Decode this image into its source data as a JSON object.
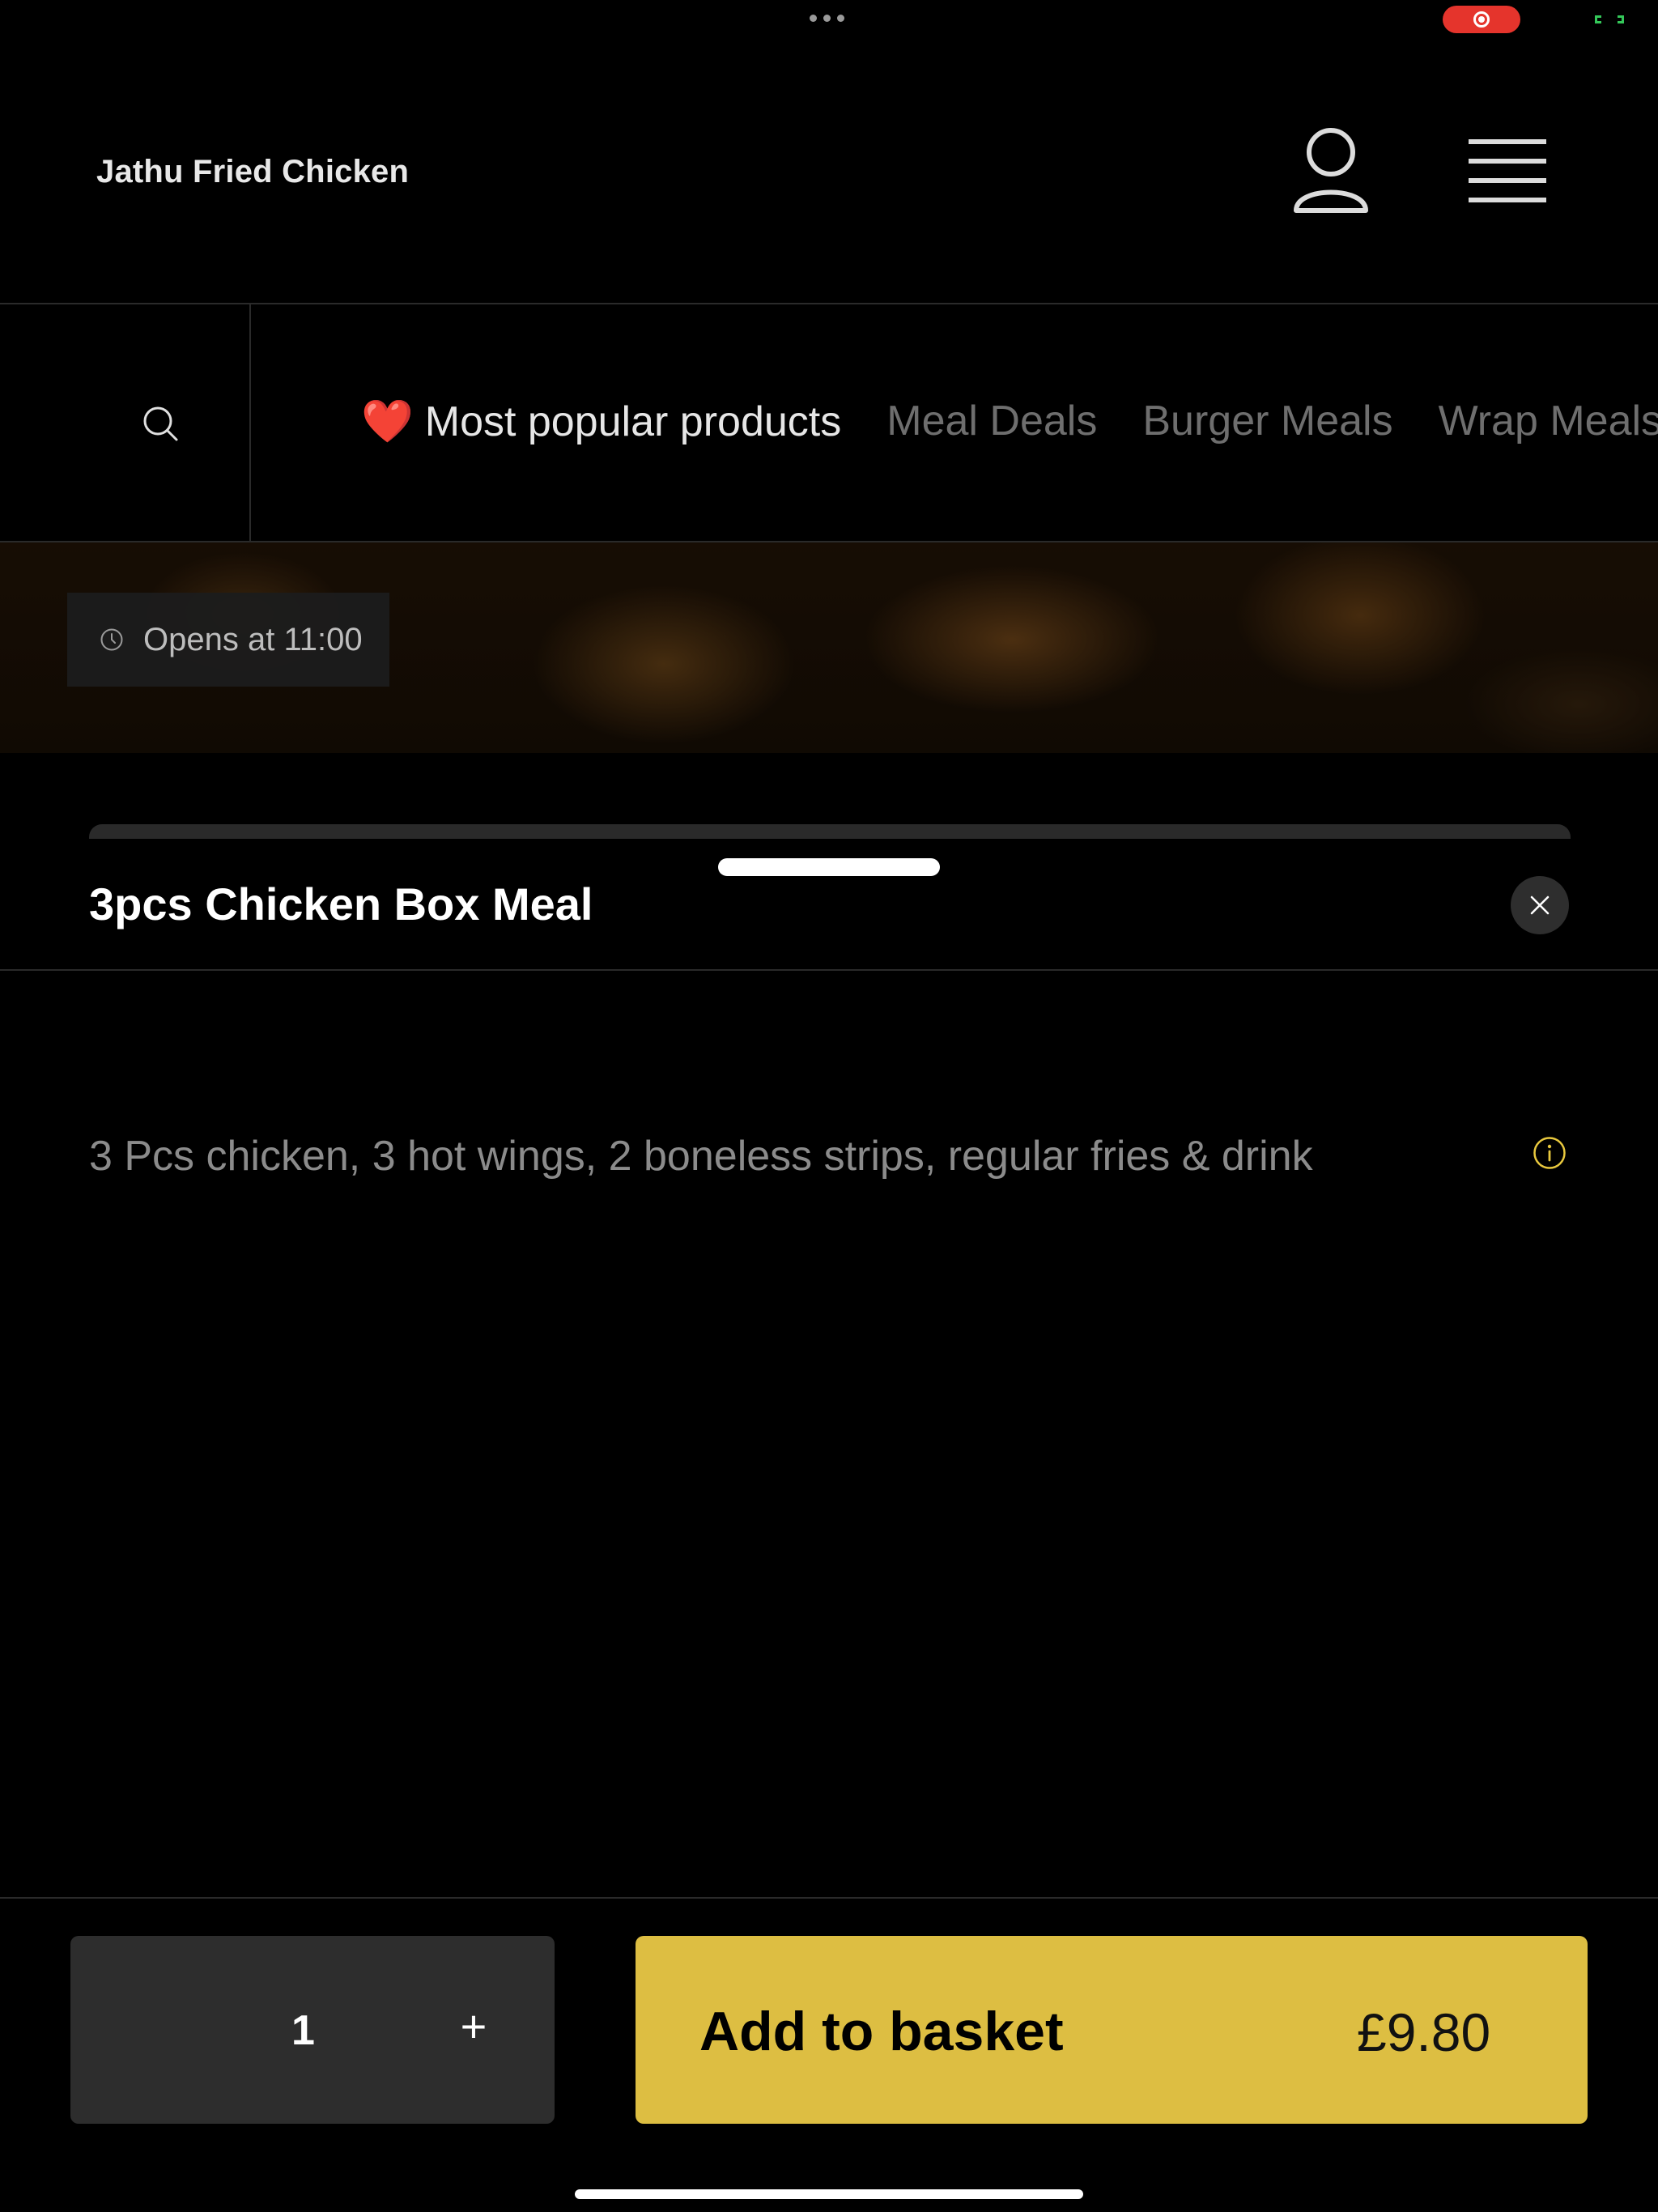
{
  "status_bar": {
    "dots_icon": "more-dots-icon",
    "record_icon": "screen-record-icon",
    "battery_icon": "battery-icon",
    "record_color": "#e5342c"
  },
  "header": {
    "brand": "Jathu Fried Chicken",
    "account_icon": "user-icon",
    "menu_icon": "hamburger-menu-icon"
  },
  "categories": {
    "search_icon": "search-icon",
    "items": [
      {
        "emoji": "❤️",
        "label": "Most popular products",
        "active": true
      },
      {
        "label": "Meal Deals",
        "active": false
      },
      {
        "label": "Burger Meals",
        "active": false
      },
      {
        "label": "Wrap Meals",
        "active": false
      }
    ]
  },
  "banner": {
    "opens_text": "Opens at 11:00",
    "clock_icon": "clock-icon"
  },
  "product": {
    "title": "3pcs Chicken Box Meal",
    "close_icon": "close-icon",
    "description": "3 Pcs chicken, 3 hot wings, 2 boneless strips, regular fries & drink",
    "info_icon": "info-icon"
  },
  "footer": {
    "quantity": "1",
    "plus_label": "+",
    "add_label": "Add to basket",
    "price": "£9.80",
    "accent_color": "#ddbe42"
  }
}
